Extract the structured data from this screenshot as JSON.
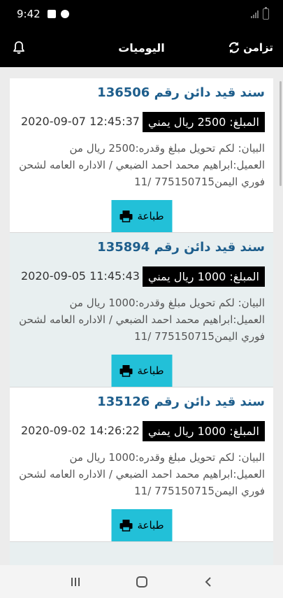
{
  "status_bar": {
    "time": "9:42"
  },
  "header": {
    "title": "اليوميات",
    "sync_label": "تزامن",
    "icons": {
      "sync": "sync-icon",
      "bell": "bell-icon"
    }
  },
  "entries": [
    {
      "title": "سند قيد دائن رقم 136506",
      "amount": "المبلغ: 2500 ريال يمني",
      "datetime": "2020-09-07 12:45:37",
      "description": "البيان: لكم تحويل مبلغ وقدره:2500  ريال من العميل:ابراهيم محمد احمد الضبعي / الاداره العامه لشحن فوري اليمن775150715 /11",
      "print_label": "طباعة"
    },
    {
      "title": "سند قيد دائن رقم 135894",
      "amount": "المبلغ: 1000 ريال يمني",
      "datetime": "2020-09-05 11:45:43",
      "description": "البيان: لكم تحويل مبلغ وقدره:1000  ريال من العميل:ابراهيم محمد احمد الضبعي / الاداره العامه لشحن فوري اليمن775150715 /11",
      "print_label": "طباعة"
    },
    {
      "title": "سند قيد دائن رقم 135126",
      "amount": "المبلغ: 1000 ريال يمني",
      "datetime": "2020-09-02 14:26:22",
      "description": "البيان: لكم تحويل مبلغ وقدره:1000  ريال من العميل:ابراهيم محمد احمد الضبعي / الاداره العامه لشحن فوري اليمن775150715 /11",
      "print_label": "طباعة"
    }
  ],
  "colors": {
    "title": "#1e5e8c",
    "print_button": "#22c0d8",
    "header": "#000000",
    "card_alt": "#e8eff0"
  }
}
